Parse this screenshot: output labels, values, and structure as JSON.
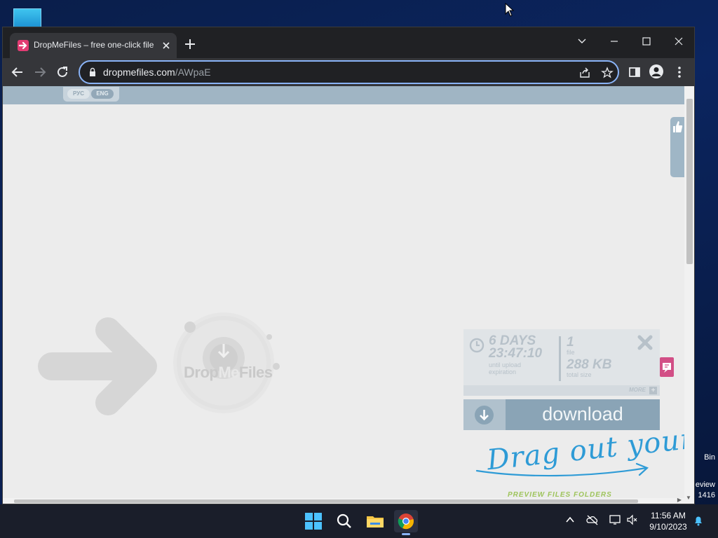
{
  "desktop": {
    "bin_label": "Bin",
    "preview_label_1": "eview",
    "preview_label_2": "1416"
  },
  "browser": {
    "tab_title": "DropMeFiles – free one-click file",
    "url_domain": "dropmefiles.com",
    "url_path": "/AWpaE"
  },
  "page": {
    "lang_ru": "РУС",
    "lang_en": "ENG",
    "logo_text_1": "Drop",
    "logo_text_2": "Me",
    "logo_text_3": "Files",
    "days": "6 DAYS",
    "time": "23:47:10",
    "expiration_label": "until upload expiration",
    "file_count": "1",
    "file_label": "file",
    "size": "288 KB",
    "size_label": "total size",
    "more_label": "MORE",
    "download_label": "download",
    "drag_text": "Drag out your",
    "drag_sub": "PREVIEW FILES FOLDERS"
  },
  "taskbar": {
    "time": "11:56 AM",
    "date": "9/10/2023"
  },
  "colors": {
    "accent": "#8ab4f8",
    "brand_pink": "#e23c73",
    "topbar": "#a0b5c4",
    "download_btn": "#8aa4b6",
    "drag_text": "#2e9bd6"
  }
}
